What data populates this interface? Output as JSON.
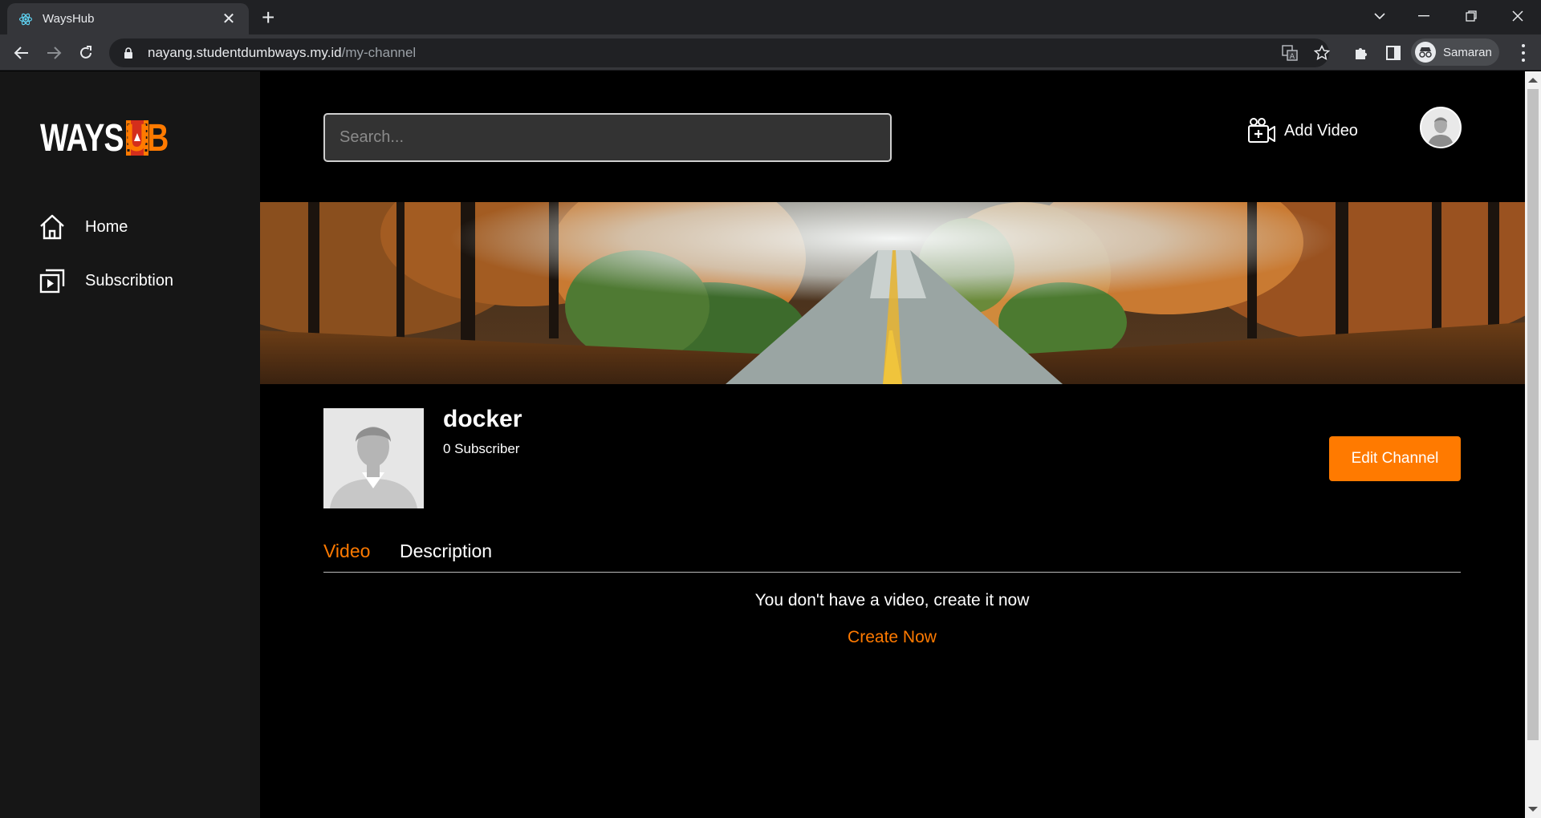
{
  "browser": {
    "tab_title": "WaysHub",
    "url_host": "nayang.studentdumbways.my.id",
    "url_path": "/my-channel",
    "profile_name": "Samaran"
  },
  "sidebar": {
    "logo_left": "WAYS",
    "logo_right": "UB",
    "items": [
      {
        "label": "Home",
        "icon": "home-icon"
      },
      {
        "label": "Subscribtion",
        "icon": "subscription-icon"
      }
    ]
  },
  "header": {
    "search_placeholder": "Search...",
    "add_video_label": "Add Video"
  },
  "channel": {
    "name": "docker",
    "subscribers": "0 Subscriber",
    "edit_button": "Edit Channel"
  },
  "tabs": [
    {
      "label": "Video",
      "active": true
    },
    {
      "label": "Description",
      "active": false
    }
  ],
  "empty_state": {
    "message": "You don't have a video, create it now",
    "action": "Create Now"
  },
  "colors": {
    "accent": "#ff7a00",
    "sidebar_bg": "#161616",
    "page_bg": "#000000"
  }
}
